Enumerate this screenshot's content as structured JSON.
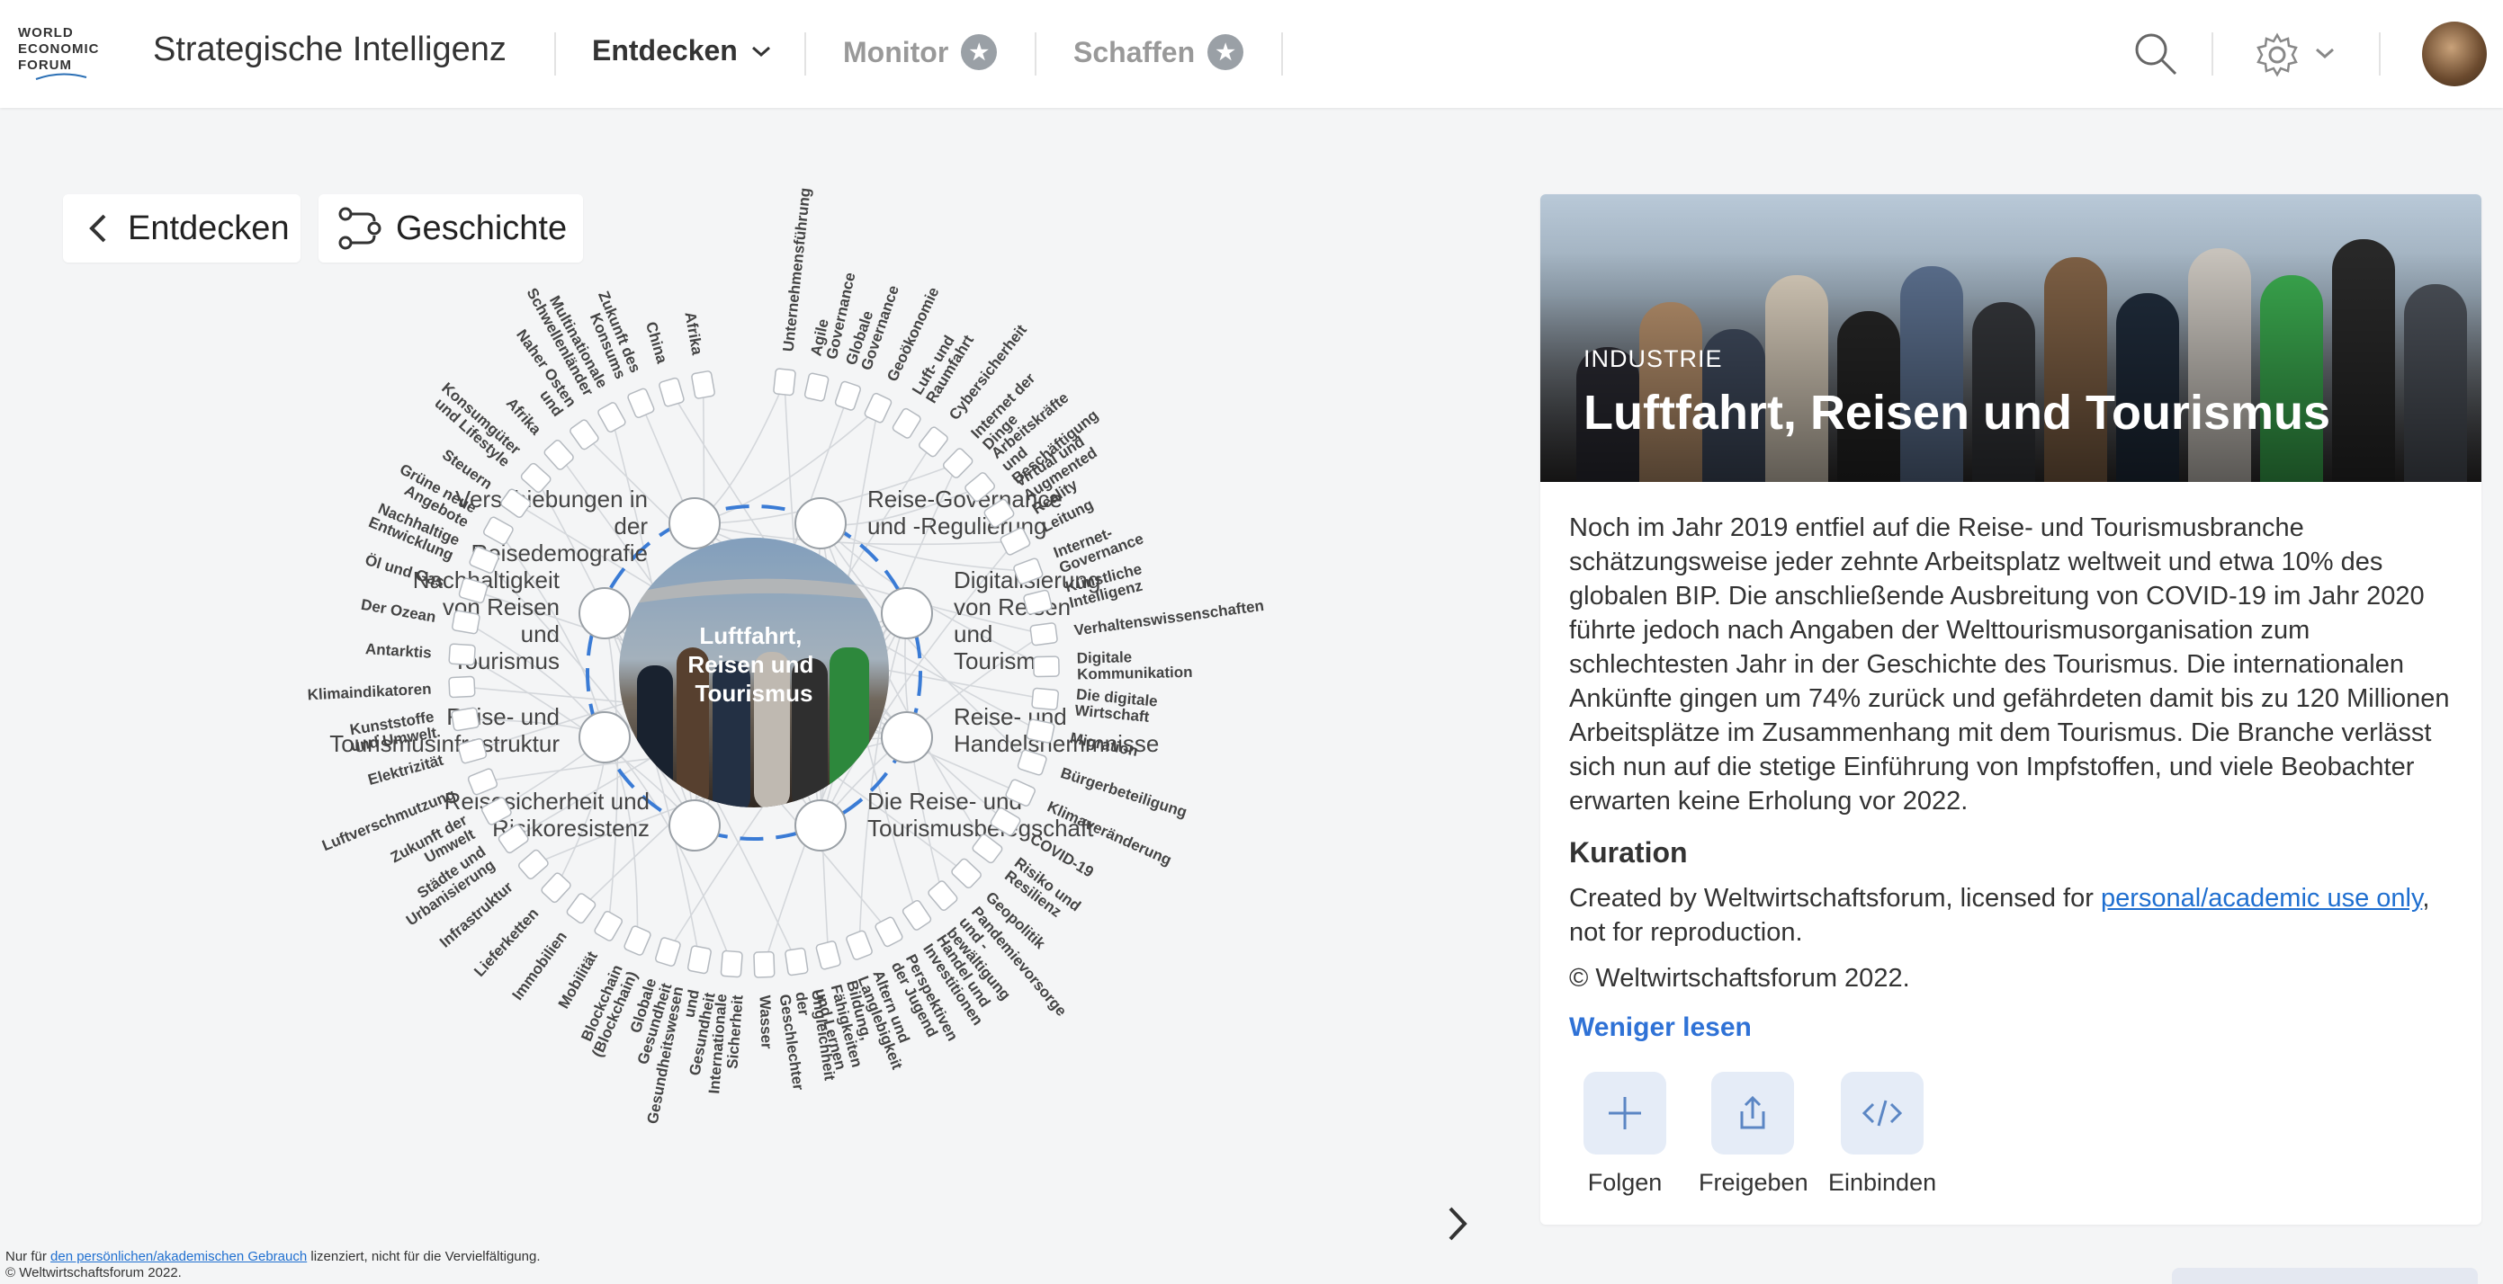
{
  "header": {
    "logo_lines": [
      "WORLD",
      "ECONOMIC",
      "FORUM"
    ],
    "app_title": "Strategische Intelligenz",
    "nav": [
      {
        "label": "Entdecken"
      },
      {
        "label": "Monitor"
      },
      {
        "label": "Schaffen"
      }
    ],
    "icons": [
      "search-icon",
      "gear-icon",
      "chevron-down-icon",
      "star-icon"
    ]
  },
  "controls": {
    "back_label": "Entdecken",
    "story_label": "Geschichte"
  },
  "viz": {
    "center_label": [
      "Luftfahrt,",
      "Reisen und",
      "Tourismus"
    ],
    "key_issues": [
      [
        "Verschiebungen in",
        "der",
        "Reisedemografie"
      ],
      [
        "Reise-Governance",
        "und -Regulierung"
      ],
      [
        "Nachhaltigkeit",
        "von Reisen",
        "und",
        "Tourismus"
      ],
      [
        "Digitalisierung",
        "von Reisen",
        "und",
        "Tourismus"
      ],
      [
        "Reise- und",
        "Tourismusinfrastruktur"
      ],
      [
        "Reise- und",
        "Handelshemmnisse"
      ],
      [
        "Reisesicherheit und",
        "Risikoresistenz"
      ],
      [
        "Die Reise- und",
        "Tourismusbelegschaft"
      ]
    ],
    "outer_labels": [
      [
        "Unternehmensführung"
      ],
      [
        "Agile",
        "Governance"
      ],
      [
        "Globale",
        "Governance"
      ],
      [
        "Geoökonomie"
      ],
      [
        "Luft- und",
        "Raumfahrt"
      ],
      [
        "Cybersicherheit"
      ],
      [
        "Internet der",
        "Dinge"
      ],
      [
        "Arbeitskräfte",
        "und",
        "Beschäftigung"
      ],
      [
        "Virtual und",
        "Augmented",
        "Reality"
      ],
      [
        "Leitung"
      ],
      [
        "Internet-",
        "Governance"
      ],
      [
        "Künstliche",
        "Intelligenz"
      ],
      [
        "Verhaltenswissenschaften"
      ],
      [
        "Digitale",
        "Kommunikation"
      ],
      [
        "Die digitale",
        "Wirtschaft"
      ],
      [
        "Migration"
      ],
      [
        "Bürgerbeteiligung"
      ],
      [
        "Klimaveränderung"
      ],
      [
        "COVID-19"
      ],
      [
        "Risiko und",
        "Resilienz"
      ],
      [
        "Geopolitik"
      ],
      [
        "Pandemievorsorge",
        "und -",
        "bewältigung"
      ],
      [
        "Handel und",
        "Investitionen"
      ],
      [
        "Perspektiven",
        "der Jugend"
      ],
      [
        "Altern und",
        "Langlebigkeit"
      ],
      [
        "Bildung,",
        "Fähigkeiten",
        "und Lernen"
      ],
      [
        "Ungleichheit",
        "der",
        "Geschlechter"
      ],
      [
        "Wasser"
      ],
      [
        "Internationale",
        "Sicherheit"
      ],
      [
        "Gesundheitswesen",
        "und",
        "Gesundheit"
      ],
      [
        "Globale",
        "Gesundheit"
      ],
      [
        "Blockchain",
        "(Blockchain)"
      ],
      [
        "Mobilität"
      ],
      [
        "Immobilien"
      ],
      [
        "Lieferketten"
      ],
      [
        "Infrastruktur"
      ],
      [
        "Städte und",
        "Urbanisierung"
      ],
      [
        "Zukunft der",
        "Umwelt"
      ],
      [
        "Luftverschmutzung"
      ],
      [
        "Elektrizität"
      ],
      [
        "Kunststoffe",
        "und Umwelt"
      ],
      [
        "Klimaindikatoren"
      ],
      [
        "Antarktis"
      ],
      [
        "Der Ozean"
      ],
      [
        "Öl und Gas"
      ],
      [
        "Nachhaltige",
        "Entwicklung"
      ],
      [
        "Grüne neue",
        "Angebote"
      ],
      [
        "Steuern"
      ],
      [
        "Konsumgüter",
        "und Lifestyle"
      ],
      [
        "Afrika"
      ],
      [
        "Naher Osten",
        "und"
      ],
      [
        "Multinationale",
        "Schwellenländer"
      ],
      [
        "Zukunft des",
        "Konsums"
      ],
      [
        "China"
      ],
      [
        "Afrika"
      ]
    ]
  },
  "panel": {
    "kicker": "INDUSTRIE",
    "title": "Luftfahrt, Reisen und Tourismus",
    "description": "Noch im Jahr 2019 entfiel auf die Reise- und Tourismusbranche schätzungsweise jeder zehnte Arbeitsplatz weltweit und etwa 10% des globalen BIP. Die anschließende Ausbreitung von COVID-19 im Jahr 2020 führte jedoch nach Angaben der Welttourismusorganisation zum schlechtesten Jahr in der Geschichte des Tourismus. Die internationalen Ankünfte gingen um 74% zurück und gefährdeten damit bis zu 120 Millionen Arbeitsplätze im Zusammenhang mit dem Tourismus. Die Branche verlässt sich nun auf die stetige Einführung von Impfstoffen, und viele Beobachter erwarten keine Erholung vor 2022.",
    "curation_heading": "Kuration",
    "curation_prefix": "Created by Weltwirtschaftsforum, licensed for ",
    "curation_link": "personal/academic use only",
    "curation_suffix": ", not for reproduction.",
    "copyright": "© Weltwirtschaftsforum 2022.",
    "read_less": "Weniger lesen",
    "actions": [
      {
        "label": "Folgen",
        "icon": "plus-icon"
      },
      {
        "label": "Freigeben",
        "icon": "share-icon"
      },
      {
        "label": "Einbinden",
        "icon": "embed-code-icon"
      }
    ]
  },
  "footer": {
    "prefix": "Nur für ",
    "link": "den persönlichen/akademischen Gebrauch",
    "suffix": " lizenziert, nicht für die Vervielfältigung.",
    "copyright": "© Weltwirtschaftsforum 2022."
  }
}
